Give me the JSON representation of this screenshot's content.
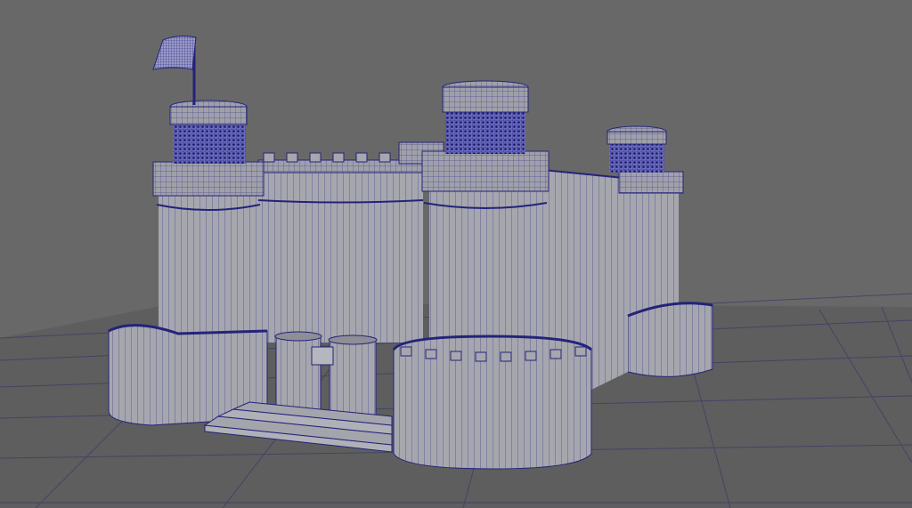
{
  "viewport": {
    "view": "perspective",
    "display_mode": "wireframe-on-shaded",
    "grid": true,
    "colors": {
      "background": "#686868",
      "grid_fill": "#5c5c5c",
      "grid_line": "#3a3a3a",
      "mesh_fill": "#a4a4ac",
      "mesh_shadow": "#8a8a92",
      "wireframe": "#23237a"
    }
  },
  "scene": {
    "model": "castle",
    "parts": [
      "curtain-wall",
      "front-left-tower",
      "front-right-tower",
      "back-right-tower",
      "back-tower",
      "gate-towers",
      "stairs",
      "flag",
      "corner-bastions"
    ]
  }
}
